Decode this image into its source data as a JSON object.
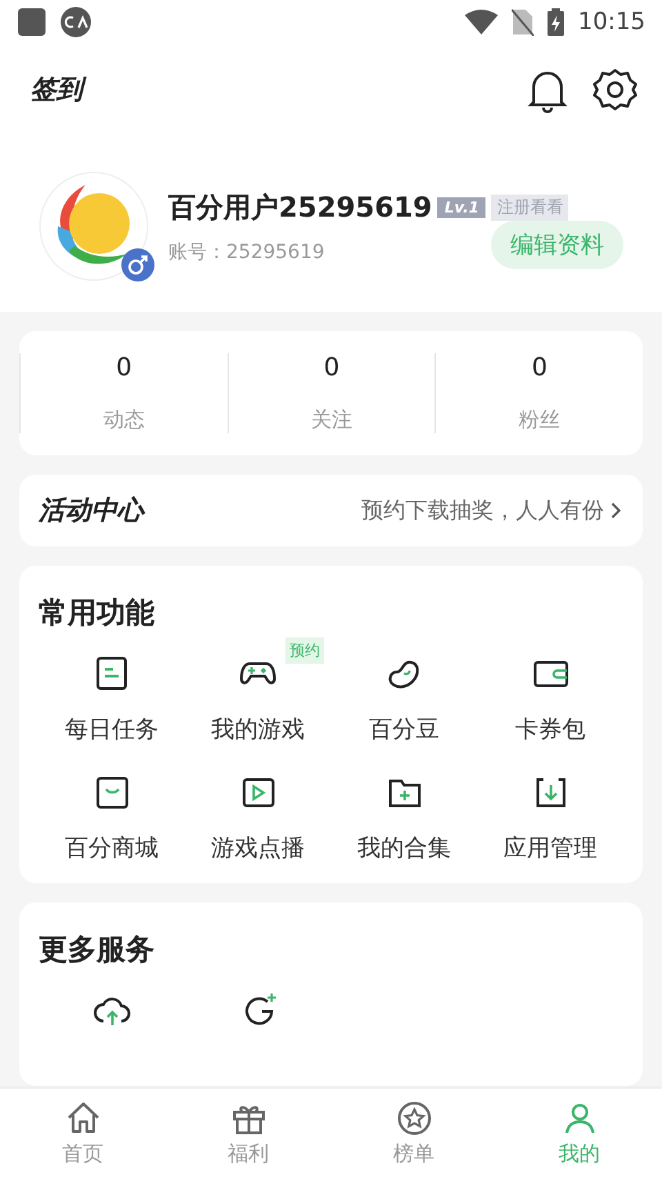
{
  "status_bar": {
    "time": "10:15"
  },
  "header": {
    "checkin": "签到"
  },
  "profile": {
    "name": "百分用户25295619",
    "level": "Lv.1",
    "level_note": "注册看看",
    "account": "账号：25295619",
    "gender_badge": {
      "kind": "male"
    },
    "edit_button": "编辑资料"
  },
  "stats": [
    {
      "value": "0",
      "label": "动态"
    },
    {
      "value": "0",
      "label": "关注"
    },
    {
      "value": "0",
      "label": "粉丝"
    }
  ],
  "activity": {
    "title": "活动中心",
    "promo": "预约下载抽奖，人人有份"
  },
  "common": {
    "title": "常用功能",
    "items": [
      {
        "kind": "task",
        "label": "每日任务"
      },
      {
        "kind": "gamepad",
        "label": "我的游戏",
        "badge": "预约"
      },
      {
        "kind": "bean",
        "label": "百分豆"
      },
      {
        "kind": "wallet",
        "label": "卡券包"
      },
      {
        "kind": "shop",
        "label": "百分商城"
      },
      {
        "kind": "play",
        "label": "游戏点播"
      },
      {
        "kind": "folder",
        "label": "我的合集"
      },
      {
        "kind": "download",
        "label": "应用管理"
      }
    ]
  },
  "more": {
    "title": "更多服务",
    "items": [
      {
        "kind": "cloud"
      },
      {
        "kind": "refresh"
      }
    ]
  },
  "tabs": [
    {
      "kind": "home",
      "label": "首页",
      "selected": false
    },
    {
      "kind": "gift",
      "label": "福利",
      "selected": false
    },
    {
      "kind": "star",
      "label": "榜单",
      "selected": false
    },
    {
      "kind": "person",
      "label": "我的",
      "selected": true
    }
  ]
}
